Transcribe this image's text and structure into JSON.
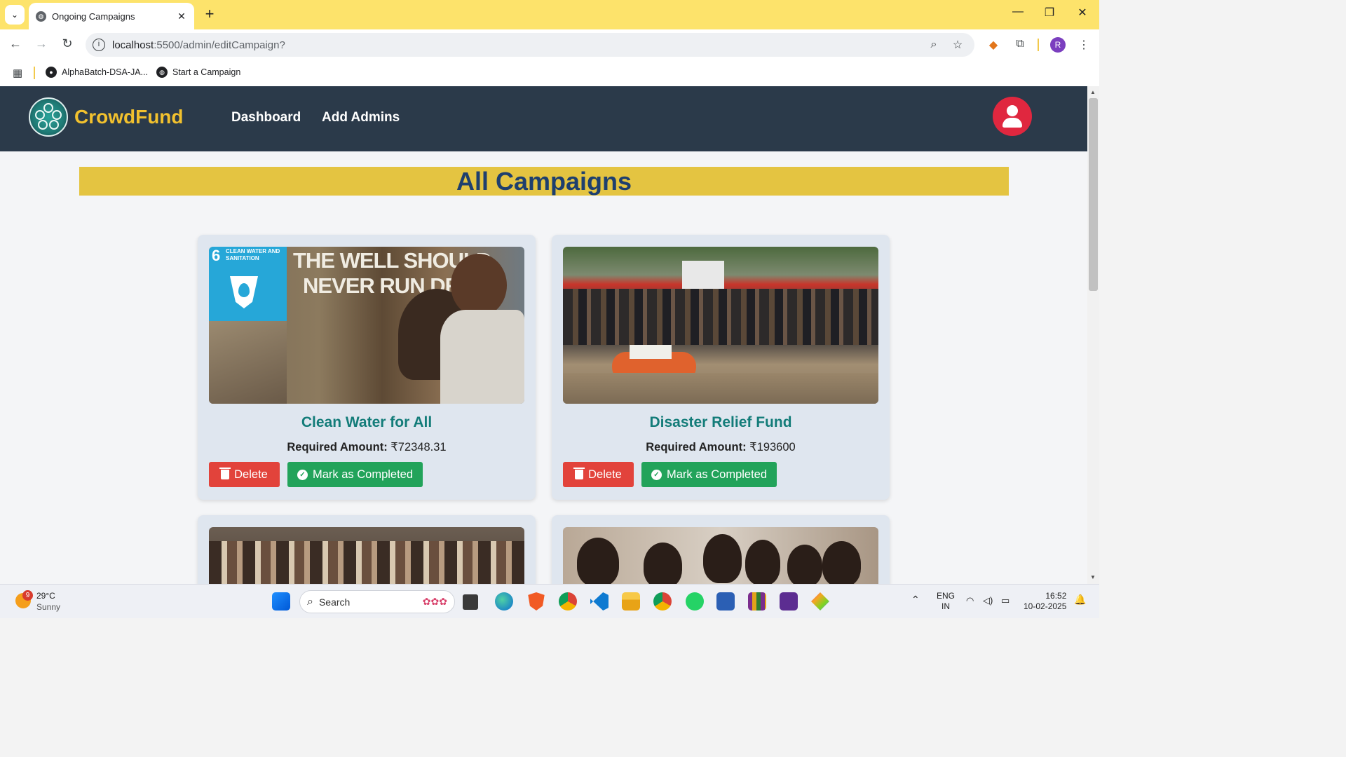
{
  "browser": {
    "tab_title": "Ongoing Campaigns",
    "url_host": "localhost",
    "url_path": ":5500/admin/editCampaign?",
    "bookmarks": [
      "AlphaBatch-DSA-JA...",
      "Start a Campaign"
    ],
    "profile_initial": "R"
  },
  "site": {
    "brand": "CrowdFund",
    "nav": [
      "Dashboard",
      "Add Admins"
    ],
    "page_heading": "All Campaigns"
  },
  "campaigns": [
    {
      "name": "Clean Water for All",
      "amount_label": "Required Amount:",
      "amount_value": "₹72348.31",
      "image_text_1": "THE WELL SHOULD",
      "image_text_2": "NEVER RUN DRY",
      "image_badge_num": "6",
      "image_badge_text": "CLEAN WATER AND SANITATION",
      "delete_label": "Delete",
      "complete_label": "Mark as Completed"
    },
    {
      "name": "Disaster Relief Fund",
      "amount_label": "Required Amount:",
      "amount_value": "₹193600",
      "delete_label": "Delete",
      "complete_label": "Mark as Completed"
    }
  ],
  "taskbar": {
    "weather_badge": "9",
    "temperature": "29°C",
    "condition": "Sunny",
    "search_placeholder": "Search",
    "language": "ENG",
    "region": "IN",
    "time": "16:52",
    "date": "10-02-2025"
  },
  "colors": {
    "browser_frame": "#fde36b",
    "site_nav": "#2b3a4a",
    "brand": "#f2c12e",
    "banner": "#e4c441",
    "heading": "#1e3f6e",
    "card_title": "#137c79",
    "delete": "#e2433b",
    "complete": "#22a35a"
  }
}
